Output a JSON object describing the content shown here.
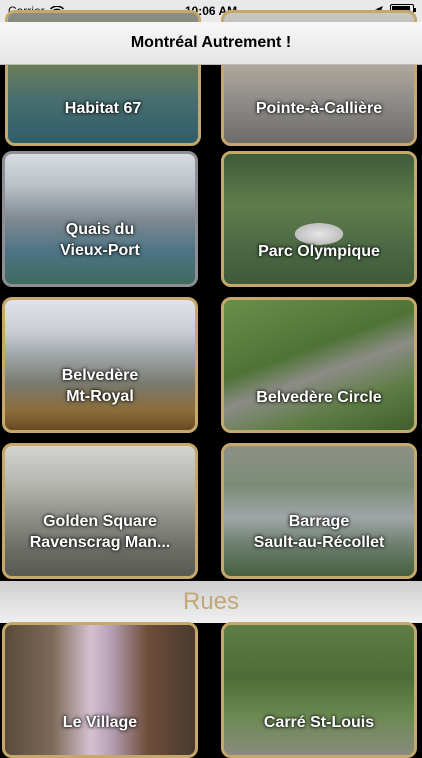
{
  "status": {
    "carrier": "Carrier",
    "time": "10:06 AM"
  },
  "nav": {
    "title": "Montréal Autrement !"
  },
  "tiles": [
    {
      "label": "Habitat 67"
    },
    {
      "label": "Pointe-à-Callière"
    },
    {
      "label": "Quais du\nVieux-Port"
    },
    {
      "label": "Parc Olympique"
    },
    {
      "label": "Belvedère\nMt-Royal"
    },
    {
      "label": "Belvedère Circle"
    },
    {
      "label": "Golden Square\nRavenscrag Man..."
    },
    {
      "label": "Barrage\nSault-au-Récollet"
    },
    {
      "label": "Le Village"
    },
    {
      "label": "Carré St-Louis"
    }
  ],
  "sections": {
    "streets": "Rues"
  },
  "icons": [
    "wifi-icon",
    "location-arrow-icon",
    "battery-icon"
  ]
}
